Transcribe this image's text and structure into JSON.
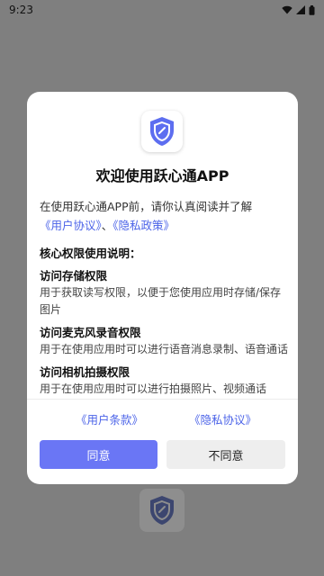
{
  "status_bar": {
    "time": "9:23",
    "icons": [
      "wifi-icon",
      "signal-icon",
      "battery-icon"
    ]
  },
  "dialog": {
    "title": "欢迎使用跃心通APP",
    "intro_text": "在使用跃心通APP前，请你认真阅读并了解",
    "intro_link_user_agreement": "《用户协议》",
    "intro_separator": "、",
    "intro_link_privacy_policy": "《隐私政策》",
    "section_heading": "核心权限使用说明：",
    "permissions": [
      {
        "title": "访问存储权限",
        "desc": "用于获取读写权限，以便于您使用应用时存储/保存图片"
      },
      {
        "title": "访问麦克风录音权限",
        "desc": "用于在使用应用时可以进行语音消息录制、语音通话"
      },
      {
        "title": "访问相机拍摄权限",
        "desc": "用于在使用应用时可以进行拍摄照片、视频通话"
      }
    ],
    "bottom_link_terms": "《用户条款》",
    "bottom_link_privacy": "《隐私协议》",
    "agree_button": "同意",
    "decline_button": "不同意"
  },
  "colors": {
    "accent": "#6a76f5",
    "link": "#4b63e8",
    "logo_primary": "#5d6ef0",
    "overlay": "#7f7f7f"
  }
}
